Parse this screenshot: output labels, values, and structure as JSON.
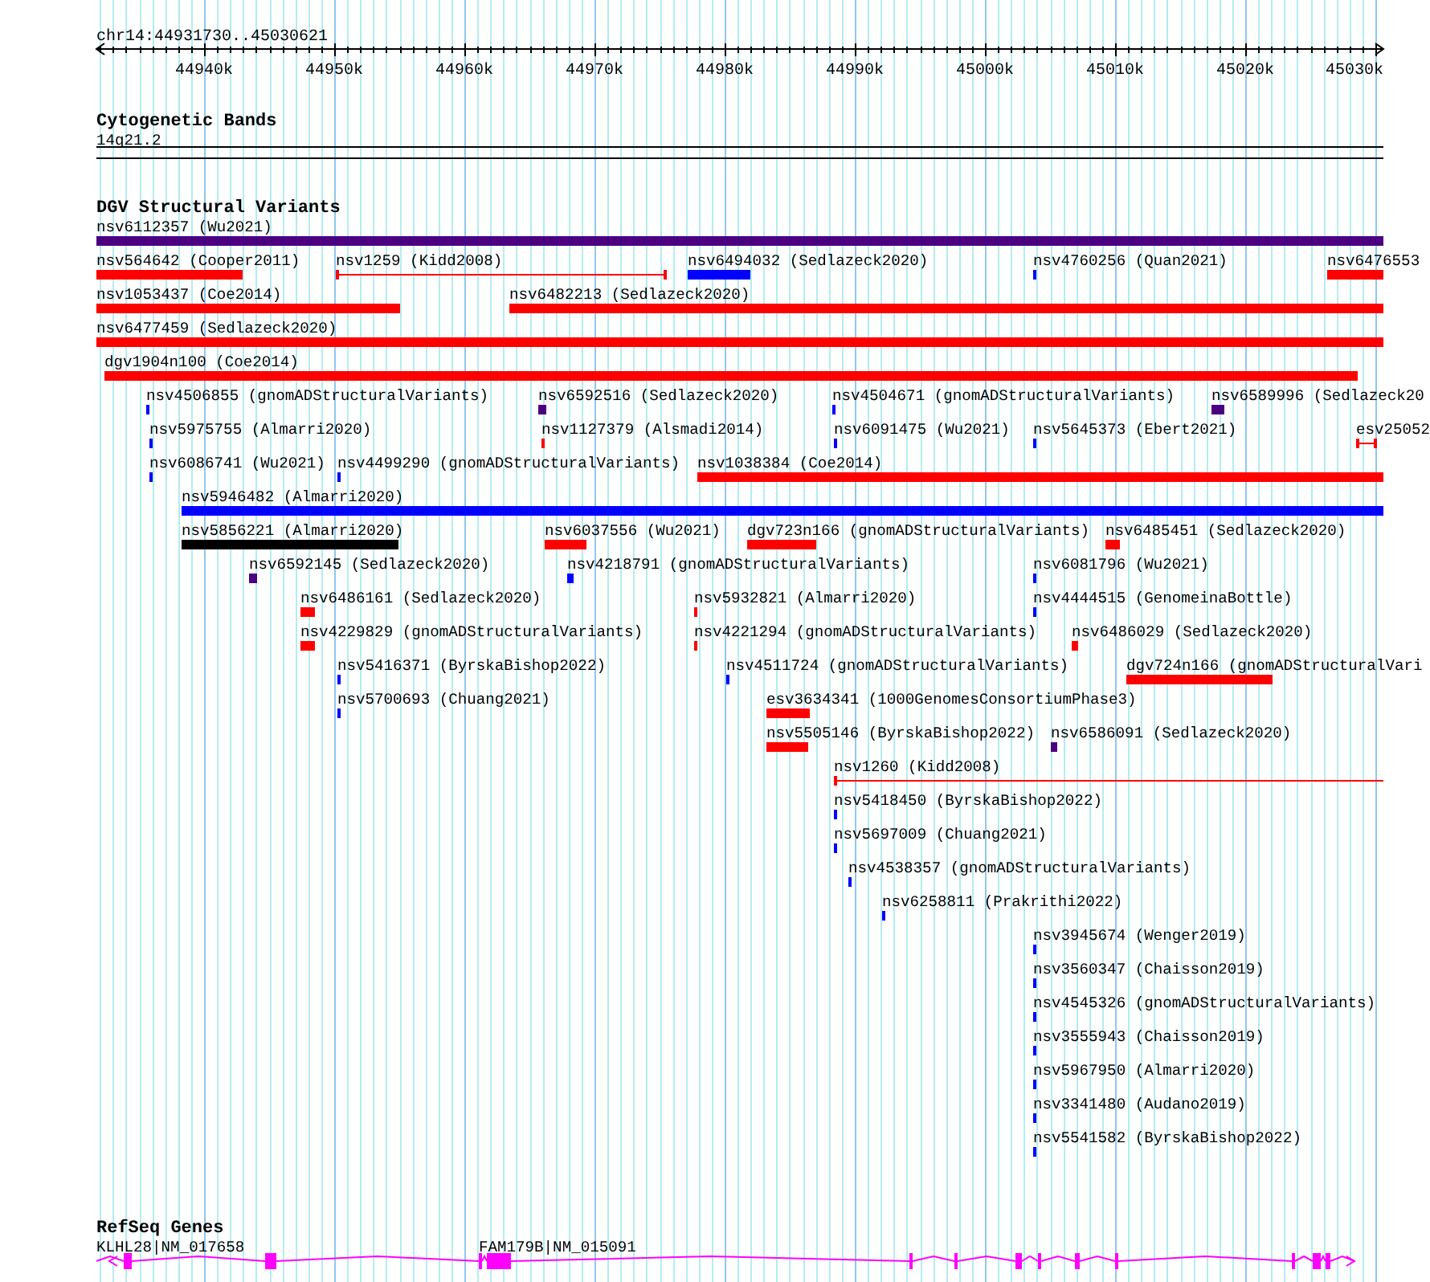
{
  "ruler": {
    "label": "chr14:44931730..45030621",
    "ticks": [
      "44940k",
      "44950k",
      "44960k",
      "44970k",
      "44980k",
      "44990k",
      "45000k",
      "45010k",
      "45020k",
      "45030k"
    ]
  },
  "tracks": [
    {
      "kind": "cytoband",
      "title": "Cytogenetic Bands",
      "band": {
        "label": "14q21.2"
      }
    },
    {
      "kind": "variants",
      "title": "DGV Structural Variants",
      "rows": [
        [
          {
            "label": "nsv6112357 (Wu2021)",
            "kind": "bar",
            "color": "#4b0082"
          }
        ],
        [
          {
            "label": "nsv564642 (Cooper2011)",
            "kind": "bar",
            "color": "#ff0000"
          },
          {
            "label": "nsv1259 (Kidd2008)",
            "kind": "span",
            "color": "#ff0000"
          },
          {
            "label": "nsv6494032 (Sedlazeck2020)",
            "kind": "bar",
            "color": "#0000ff"
          },
          {
            "label": "nsv4760256 (Quan2021)",
            "kind": "bar",
            "color": "#0000ff"
          },
          {
            "label": "nsv6476553",
            "kind": "bar",
            "color": "#ff0000"
          }
        ],
        [
          {
            "label": "nsv1053437 (Coe2014)",
            "kind": "bar",
            "color": "#ff0000"
          },
          {
            "label": "nsv6482213 (Sedlazeck2020)",
            "kind": "bar",
            "color": "#ff0000"
          }
        ],
        [
          {
            "label": "nsv6477459 (Sedlazeck2020)",
            "kind": "bar",
            "color": "#ff0000"
          }
        ],
        [
          {
            "label": "dgv1904n100 (Coe2014)",
            "kind": "bar",
            "color": "#ff0000"
          }
        ],
        [
          {
            "label": "nsv4506855 (gnomADStructuralVariants)",
            "kind": "bar",
            "color": "#0000ff"
          },
          {
            "label": "nsv6592516 (Sedlazeck2020)",
            "kind": "bar",
            "color": "#4b0082"
          },
          {
            "label": "nsv4504671 (gnomADStructuralVariants)",
            "kind": "bar",
            "color": "#0000ff"
          },
          {
            "label": "nsv6589996 (Sedlazeck20",
            "kind": "bar",
            "color": "#4b0082"
          }
        ],
        [
          {
            "label": "nsv5975755 (Almarri2020)",
            "kind": "bar",
            "color": "#0000ff"
          },
          {
            "label": "nsv1127379 (Alsmadi2014)",
            "kind": "bar",
            "color": "#ff0000"
          },
          {
            "label": "nsv6091475 (Wu2021)",
            "kind": "bar",
            "color": "#0000ff"
          },
          {
            "label": "nsv5645373 (Ebert2021)",
            "kind": "bar",
            "color": "#0000ff"
          },
          {
            "label": "esv25052",
            "kind": "span",
            "color": "#ff0000"
          }
        ],
        [
          {
            "label": "nsv6086741 (Wu2021)",
            "kind": "bar",
            "color": "#0000ff"
          },
          {
            "label": "nsv4499290 (gnomADStructuralVariants)",
            "kind": "bar",
            "color": "#0000ff"
          },
          {
            "label": "nsv1038384 (Coe2014)",
            "kind": "bar",
            "color": "#ff0000"
          }
        ],
        [
          {
            "label": "nsv5946482 (Almarri2020)",
            "kind": "bar",
            "color": "#0000ff"
          }
        ],
        [
          {
            "label": "nsv5856221 (Almarri2020)",
            "kind": "bar",
            "color": "#000000"
          },
          {
            "label": "nsv6037556 (Wu2021)",
            "kind": "bar",
            "color": "#ff0000"
          },
          {
            "label": "dgv723n166 (gnomADStructuralVariants)",
            "kind": "bar",
            "color": "#ff0000"
          },
          {
            "label": "nsv6485451 (Sedlazeck2020)",
            "kind": "bar",
            "color": "#ff0000"
          }
        ],
        [
          {
            "label": "nsv6592145 (Sedlazeck2020)",
            "kind": "bar",
            "color": "#4b0082"
          },
          {
            "label": "nsv4218791 (gnomADStructuralVariants)",
            "kind": "bar",
            "color": "#0000ff"
          },
          {
            "label": "nsv6081796 (Wu2021)",
            "kind": "bar",
            "color": "#0000ff"
          }
        ],
        [
          {
            "label": "nsv6486161 (Sedlazeck2020)",
            "kind": "bar",
            "color": "#ff0000"
          },
          {
            "label": "nsv5932821 (Almarri2020)",
            "kind": "bar",
            "color": "#ff0000"
          },
          {
            "label": "nsv4444515 (GenomeinaBottle)",
            "kind": "bar",
            "color": "#0000ff"
          }
        ],
        [
          {
            "label": "nsv4229829 (gnomADStructuralVariants)",
            "kind": "bar",
            "color": "#ff0000"
          },
          {
            "label": "nsv4221294 (gnomADStructuralVariants)",
            "kind": "bar",
            "color": "#ff0000"
          },
          {
            "label": "nsv6486029 (Sedlazeck2020)",
            "kind": "bar",
            "color": "#ff0000"
          }
        ],
        [
          {
            "label": "nsv5416371 (ByrskaBishop2022)",
            "kind": "bar",
            "color": "#0000ff"
          },
          {
            "label": "nsv4511724 (gnomADStructuralVariants)",
            "kind": "bar",
            "color": "#0000ff"
          },
          {
            "label": "dgv724n166 (gnomADStructuralVari",
            "kind": "bar",
            "color": "#ff0000"
          }
        ],
        [
          {
            "label": "nsv5700693 (Chuang2021)",
            "kind": "bar",
            "color": "#0000ff"
          },
          {
            "label": "esv3634341 (1000GenomesConsortiumPhase3)",
            "kind": "bar",
            "color": "#ff0000"
          }
        ],
        [
          {
            "label": "nsv5505146 (ByrskaBishop2022)",
            "kind": "bar",
            "color": "#ff0000"
          },
          {
            "label": "nsv6586091 (Sedlazeck2020)",
            "kind": "bar",
            "color": "#4b0082"
          }
        ],
        [
          {
            "label": "nsv1260 (Kidd2008)",
            "kind": "span",
            "color": "#ff0000"
          }
        ],
        [
          {
            "label": "nsv5418450 (ByrskaBishop2022)",
            "kind": "bar",
            "color": "#0000ff"
          }
        ],
        [
          {
            "label": "nsv5697009 (Chuang2021)",
            "kind": "bar",
            "color": "#0000ff"
          }
        ],
        [
          {
            "label": "nsv4538357 (gnomADStructuralVariants)",
            "kind": "bar",
            "color": "#0000ff"
          }
        ],
        [
          {
            "label": "nsv6258811 (Prakrithi2022)",
            "kind": "bar",
            "color": "#0000ff"
          }
        ],
        [
          {
            "label": "nsv3945674 (Wenger2019)",
            "kind": "bar",
            "color": "#0000ff"
          }
        ],
        [
          {
            "label": "nsv3560347 (Chaisson2019)",
            "kind": "bar",
            "color": "#0000ff"
          }
        ],
        [
          {
            "label": "nsv4545326 (gnomADStructuralVariants)",
            "kind": "bar",
            "color": "#0000ff"
          }
        ],
        [
          {
            "label": "nsv3555943 (Chaisson2019)",
            "kind": "bar",
            "color": "#0000ff"
          }
        ],
        [
          {
            "label": "nsv5967950 (Almarri2020)",
            "kind": "bar",
            "color": "#0000ff"
          }
        ],
        [
          {
            "label": "nsv3341480 (Audano2019)",
            "kind": "bar",
            "color": "#0000ff"
          }
        ],
        [
          {
            "label": "nsv5541582 (ByrskaBishop2022)",
            "kind": "bar",
            "color": "#0000ff"
          }
        ]
      ]
    },
    {
      "kind": "genes",
      "title": "RefSeq Genes",
      "genes": [
        {
          "label": "KLHL28|NM_017658",
          "reverse": true
        },
        {
          "label": "FAM179B|NM_015091",
          "reverse": false
        }
      ]
    }
  ]
}
